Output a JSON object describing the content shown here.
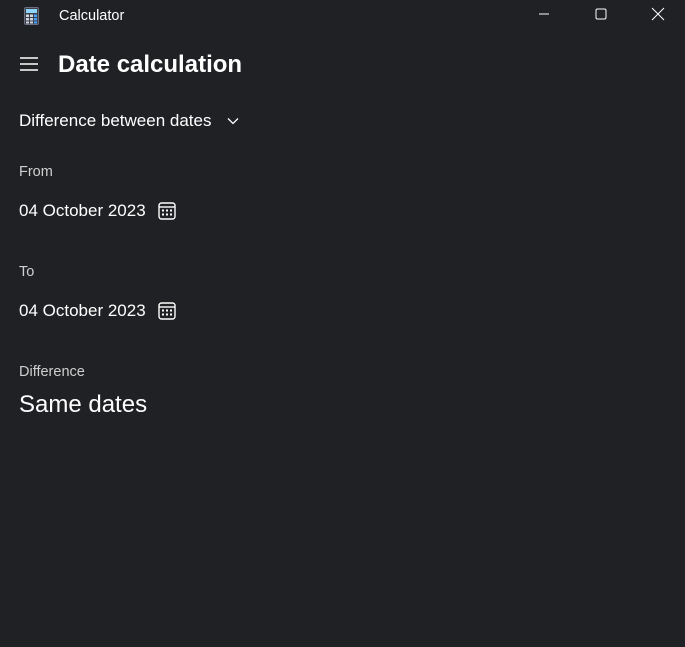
{
  "window": {
    "title": "Calculator",
    "icon": "calculator-icon",
    "controls": [
      "minimize-icon",
      "maximize-icon",
      "close-icon"
    ]
  },
  "header": {
    "menu_icon": "hamburger-menu-icon",
    "title": "Date calculation"
  },
  "mode": {
    "selected": "Difference between dates",
    "icon": "chevron-down-icon"
  },
  "from": {
    "label": "From",
    "value": "04 October 2023",
    "icon": "calendar-icon"
  },
  "to": {
    "label": "To",
    "value": "04 October 2023",
    "icon": "calendar-icon"
  },
  "difference": {
    "label": "Difference",
    "value": "Same dates"
  },
  "colors": {
    "background": "#202124",
    "text": "#ffffff",
    "label_text": "#d0d0d0"
  }
}
